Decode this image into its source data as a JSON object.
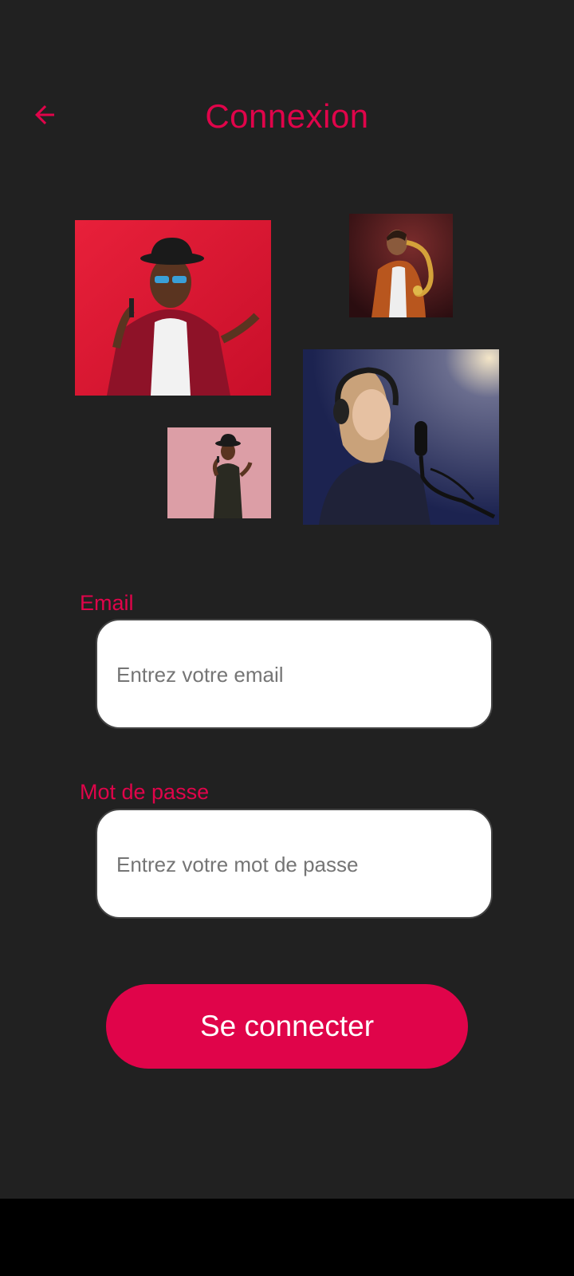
{
  "header": {
    "title": "Connexion",
    "back_icon": "arrow-left-icon"
  },
  "gallery": {
    "photos": [
      {
        "name": "singer-red-jacket-photo"
      },
      {
        "name": "saxophone-player-photo"
      },
      {
        "name": "singer-pink-background-photo"
      },
      {
        "name": "studio-singer-headphones-photo"
      }
    ]
  },
  "form": {
    "email": {
      "label": "Email",
      "placeholder": "Entrez votre email",
      "value": ""
    },
    "password": {
      "label": "Mot de passe",
      "placeholder": "Entrez votre mot de passe",
      "value": ""
    },
    "submit_label": "Se connecter"
  },
  "colors": {
    "accent": "#e0044a",
    "background": "#212121",
    "input_background": "#ffffff",
    "placeholder": "#757575"
  }
}
